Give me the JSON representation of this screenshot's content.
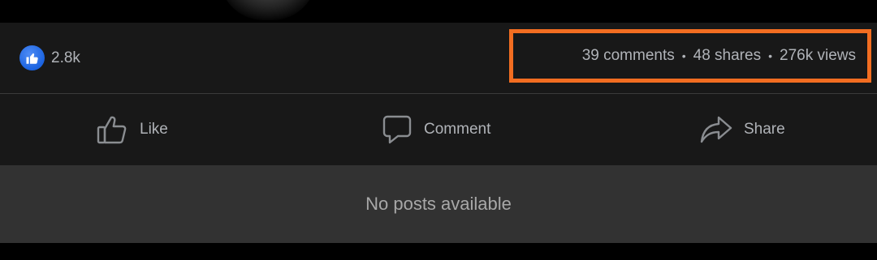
{
  "reactions": {
    "icon": "thumbs-up-icon",
    "count": "2.8k",
    "badge_color": "#1b63e0"
  },
  "stats": {
    "comments": "39 comments",
    "shares": "48 shares",
    "views": "276k views",
    "separator": "•",
    "highlight_color": "#f26d21"
  },
  "actions": {
    "like": {
      "label": "Like",
      "icon": "thumbs-up-outline-icon"
    },
    "comment": {
      "label": "Comment",
      "icon": "speech-bubble-icon"
    },
    "share": {
      "label": "Share",
      "icon": "share-arrow-icon"
    }
  },
  "feed": {
    "empty_message": "No posts available"
  },
  "colors": {
    "panel": "#181818",
    "empty_bg": "#323232",
    "text_muted": "#b0b3b8"
  }
}
